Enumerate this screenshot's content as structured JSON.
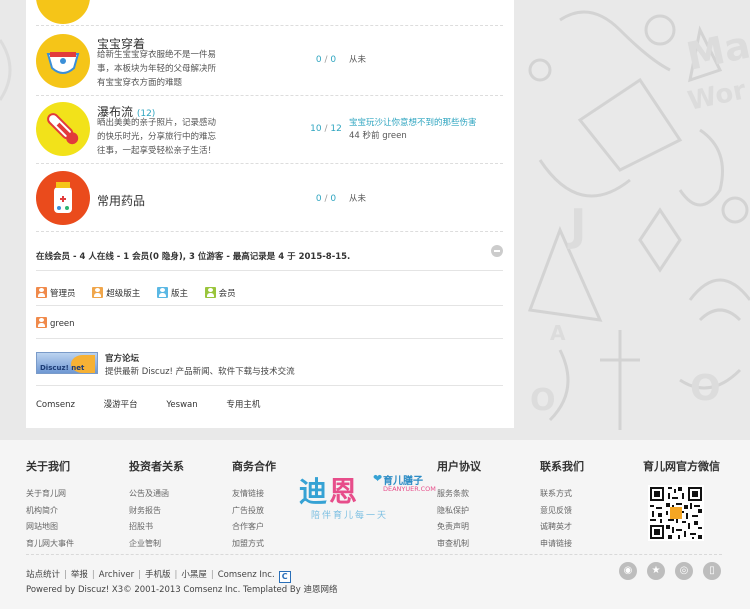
{
  "forums": [
    {
      "name": "宝宝穿着",
      "count": "",
      "desc": [
        "给新生宝宝穿衣服绝不是一件易",
        "事，本板块为年轻的父母解决所",
        "有宝宝穿衣方面的难题"
      ],
      "threads": "0",
      "posts": "0",
      "last_line1": "从未",
      "last_line2": "",
      "icon_color": "#f5c518",
      "icon": "diaper-icon"
    },
    {
      "name": "瀑布流",
      "count": "(12)",
      "desc": [
        "晒出美美的亲子照片，记录感动",
        "的快乐时光，分享旅行中的难忘",
        "往事，一起享受轻松亲子生活！"
      ],
      "threads": "10",
      "posts": "12",
      "last_line1": "宝宝玩沙让你意想不到的那些伤害",
      "last_line2": "44 秒前 green",
      "icon_color": "#f2e21a",
      "icon": "thermometer-icon"
    },
    {
      "name": "常用药品",
      "count": "",
      "desc": [],
      "threads": "0",
      "posts": "0",
      "last_line1": "从未",
      "last_line2": "",
      "icon_color": "#ea4b1c",
      "icon": "medicine-bottle-icon"
    }
  ],
  "stat_sep": " / ",
  "online": {
    "prefix": "在线会员",
    "text": " - 4 人在线 - 1 会员(0 隐身), 3 位游客 - 最高记录是 4 于 2015-8-15."
  },
  "legend": [
    {
      "label": "管理员",
      "color": "#f08a4b"
    },
    {
      "label": "超级版主",
      "color": "#f0a64b"
    },
    {
      "label": "版主",
      "color": "#5bb8e4"
    },
    {
      "label": "会员",
      "color": "#9ac53c"
    }
  ],
  "online_member": {
    "name": "green",
    "color": "#f08a4b"
  },
  "official": {
    "logo_text": "Discuz! net",
    "title": "官方论坛",
    "desc": "提供最新 Discuz! 产品新闻、软件下载与技术交流"
  },
  "friend_links": [
    "Comsenz",
    "漫游平台",
    "Yeswan",
    "专用主机"
  ],
  "footer": {
    "columns": [
      {
        "title": "关于我们",
        "links": [
          "关于育儿网",
          "机构简介",
          "网站地图",
          "育儿网大事件"
        ]
      },
      {
        "title": "投资者关系",
        "links": [
          "公告及通函",
          "财务报告",
          "招股书",
          "企业管制"
        ]
      },
      {
        "title": "商务合作",
        "links": [
          "友情链接",
          "广告投放",
          "合作客户",
          "加盟方式"
        ]
      },
      {
        "title": "用户协议",
        "links": [
          "服务条款",
          "隐私保护",
          "免责声明",
          "审查机制"
        ]
      },
      {
        "title": "联系我们",
        "links": [
          "联系方式",
          "意见反馈",
          "诚聘英才",
          "申请链接"
        ]
      },
      {
        "title": "育儿网官方微信",
        "links": []
      }
    ],
    "brand": {
      "big1": "迪",
      "big2": "恩",
      "sub1": "育儿膳子",
      "sub2": "DEANYUER.COM",
      "slogan": "陪伴育儿每一天"
    },
    "bar_links": [
      "站点统计",
      "举报",
      "Archiver",
      "手机版",
      "小黑屋",
      "Comsenz Inc."
    ],
    "powered": "Powered by Discuz! X3© 2001-2013 Comsenz Inc. Templated By 迪恩网络",
    "social_icons": [
      "weibo-icon",
      "star-icon",
      "tencent-weibo-icon",
      "mobile-icon"
    ]
  }
}
